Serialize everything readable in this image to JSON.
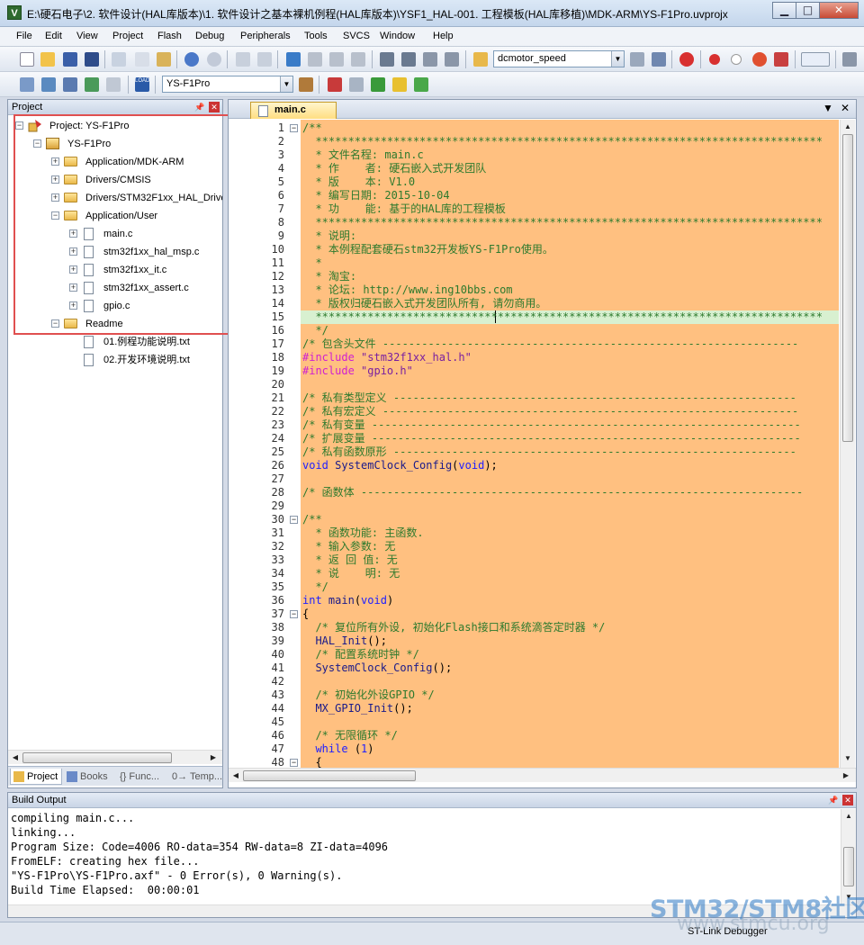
{
  "window": {
    "title": "E:\\硬石电子\\2. 软件设计(HAL库版本)\\1. 软件设计之基本裸机例程(HAL库版本)\\YSF1_HAL-001. 工程模板(HAL库移植)\\MDK-ARM\\YS-F1Pro.uvprojx",
    "app_icon_letter": "V"
  },
  "menu": [
    "File",
    "Edit",
    "View",
    "Project",
    "Flash",
    "Debug",
    "Peripherals",
    "Tools",
    "SVCS",
    "Window",
    "Help"
  ],
  "toolbar": {
    "find_combo_value": "dcmotor_speed",
    "target_combo_value": "YS-F1Pro",
    "load_label": "LOAD"
  },
  "project_panel": {
    "title": "Project",
    "tree": [
      {
        "label": "Project: YS-F1Pro",
        "level": 0,
        "type": "project",
        "expander": "−"
      },
      {
        "label": "YS-F1Pro",
        "level": 1,
        "type": "target",
        "expander": "−"
      },
      {
        "label": "Application/MDK-ARM",
        "level": 2,
        "type": "folder",
        "expander": "+"
      },
      {
        "label": "Drivers/CMSIS",
        "level": 2,
        "type": "folder",
        "expander": "+"
      },
      {
        "label": "Drivers/STM32F1xx_HAL_Driver",
        "level": 2,
        "type": "folder",
        "expander": "+"
      },
      {
        "label": "Application/User",
        "level": 2,
        "type": "folder",
        "expander": "−"
      },
      {
        "label": "main.c",
        "level": 3,
        "type": "file",
        "expander": "+"
      },
      {
        "label": "stm32f1xx_hal_msp.c",
        "level": 3,
        "type": "file",
        "expander": "+"
      },
      {
        "label": "stm32f1xx_it.c",
        "level": 3,
        "type": "file",
        "expander": "+"
      },
      {
        "label": "stm32f1xx_assert.c",
        "level": 3,
        "type": "file",
        "expander": "+"
      },
      {
        "label": "gpio.c",
        "level": 3,
        "type": "file",
        "expander": "+"
      },
      {
        "label": "Readme",
        "level": 2,
        "type": "folder",
        "expander": "−"
      },
      {
        "label": "01.例程功能说明.txt",
        "level": 3,
        "type": "file",
        "expander": ""
      },
      {
        "label": "02.开发环境说明.txt",
        "level": 3,
        "type": "file",
        "expander": ""
      }
    ],
    "tabs": [
      "Project",
      "Books",
      "{} Func...",
      "0→ Temp..."
    ]
  },
  "editor": {
    "active_tab": "main.c",
    "lines": [
      {
        "n": "1",
        "fold": "−",
        "segs": [
          [
            "c-comment",
            "/**"
          ]
        ]
      },
      {
        "n": "2",
        "segs": [
          [
            "c-comment",
            "  ******************************************************************************"
          ]
        ]
      },
      {
        "n": "3",
        "segs": [
          [
            "c-comment",
            "  * 文件名程: main.c"
          ]
        ]
      },
      {
        "n": "4",
        "segs": [
          [
            "c-comment",
            "  * 作    者: 硬石嵌入式开发团队"
          ]
        ]
      },
      {
        "n": "5",
        "segs": [
          [
            "c-comment",
            "  * 版    本: V1.0"
          ]
        ]
      },
      {
        "n": "6",
        "segs": [
          [
            "c-comment",
            "  * 编写日期: 2015-10-04"
          ]
        ]
      },
      {
        "n": "7",
        "segs": [
          [
            "c-comment",
            "  * 功    能: 基于的HAL库的工程模板"
          ]
        ]
      },
      {
        "n": "8",
        "segs": [
          [
            "c-comment",
            "  ******************************************************************************"
          ]
        ]
      },
      {
        "n": "9",
        "segs": [
          [
            "c-comment",
            "  * 说明:"
          ]
        ]
      },
      {
        "n": "10",
        "segs": [
          [
            "c-comment",
            "  * 本例程配套硬石stm32开发板YS-F1Pro使用。"
          ]
        ]
      },
      {
        "n": "11",
        "segs": [
          [
            "c-comment",
            "  *"
          ]
        ]
      },
      {
        "n": "12",
        "segs": [
          [
            "c-comment",
            "  * 淘宝:"
          ]
        ]
      },
      {
        "n": "13",
        "segs": [
          [
            "c-comment",
            "  * 论坛: http://www.ing10bbs.com"
          ]
        ]
      },
      {
        "n": "14",
        "segs": [
          [
            "c-comment",
            "  * 版权归硬石嵌入式开发团队所有, 请勿商用。"
          ]
        ]
      },
      {
        "n": "15",
        "segs": [
          [
            "c-comment",
            "  ******************************************************************************"
          ]
        ],
        "highlight": true
      },
      {
        "n": "16",
        "segs": [
          [
            "c-comment",
            "  */"
          ]
        ]
      },
      {
        "n": "17",
        "segs": [
          [
            "c-comment",
            "/* 包含头文件 ----------------------------------------------------------------"
          ]
        ]
      },
      {
        "n": "18",
        "segs": [
          [
            "c-pre",
            "#include "
          ],
          [
            "c-str",
            "\"stm32f1xx_hal.h\""
          ]
        ]
      },
      {
        "n": "19",
        "segs": [
          [
            "c-pre",
            "#include "
          ],
          [
            "c-str",
            "\"gpio.h\""
          ]
        ]
      },
      {
        "n": "20",
        "segs": [
          [
            "c-txt",
            ""
          ]
        ]
      },
      {
        "n": "21",
        "segs": [
          [
            "c-comment",
            "/* 私有类型定义 --------------------------------------------------------------"
          ]
        ]
      },
      {
        "n": "22",
        "segs": [
          [
            "c-comment",
            "/* 私有宏定义 ----------------------------------------------------------------"
          ]
        ]
      },
      {
        "n": "23",
        "segs": [
          [
            "c-comment",
            "/* 私有变量 ------------------------------------------------------------------"
          ]
        ]
      },
      {
        "n": "24",
        "segs": [
          [
            "c-comment",
            "/* 扩展变量 ------------------------------------------------------------------"
          ]
        ]
      },
      {
        "n": "25",
        "segs": [
          [
            "c-comment",
            "/* 私有函数原形 --------------------------------------------------------------"
          ]
        ]
      },
      {
        "n": "26",
        "segs": [
          [
            "c-kw",
            "void "
          ],
          [
            "c-fn",
            "SystemClock_Config"
          ],
          [
            "c-txt",
            "("
          ],
          [
            "c-kw",
            "void"
          ],
          [
            "c-txt",
            ");"
          ]
        ]
      },
      {
        "n": "27",
        "segs": [
          [
            "c-txt",
            ""
          ]
        ]
      },
      {
        "n": "28",
        "segs": [
          [
            "c-comment",
            "/* 函数体 --------------------------------------------------------------------"
          ]
        ]
      },
      {
        "n": "29",
        "segs": [
          [
            "c-txt",
            ""
          ]
        ]
      },
      {
        "n": "30",
        "fold": "−",
        "segs": [
          [
            "c-comment",
            "/**"
          ]
        ]
      },
      {
        "n": "31",
        "segs": [
          [
            "c-comment",
            "  * 函数功能: 主函数."
          ]
        ]
      },
      {
        "n": "32",
        "segs": [
          [
            "c-comment",
            "  * 输入参数: 无"
          ]
        ]
      },
      {
        "n": "33",
        "segs": [
          [
            "c-comment",
            "  * 返 回 值: 无"
          ]
        ]
      },
      {
        "n": "34",
        "segs": [
          [
            "c-comment",
            "  * 说    明: 无"
          ]
        ]
      },
      {
        "n": "35",
        "segs": [
          [
            "c-comment",
            "  */"
          ]
        ]
      },
      {
        "n": "36",
        "segs": [
          [
            "c-kw",
            "int "
          ],
          [
            "c-fn",
            "main"
          ],
          [
            "c-txt",
            "("
          ],
          [
            "c-kw",
            "void"
          ],
          [
            "c-txt",
            ")"
          ]
        ]
      },
      {
        "n": "37",
        "fold": "−",
        "segs": [
          [
            "c-txt",
            "{"
          ]
        ]
      },
      {
        "n": "38",
        "segs": [
          [
            "c-comment",
            "  /* 复位所有外设, 初始化Flash接口和系统滴答定时器 */"
          ]
        ]
      },
      {
        "n": "39",
        "segs": [
          [
            "c-txt",
            "  "
          ],
          [
            "c-fn",
            "HAL_Init"
          ],
          [
            "c-txt",
            "();"
          ]
        ]
      },
      {
        "n": "40",
        "segs": [
          [
            "c-comment",
            "  /* 配置系统时钟 */"
          ]
        ]
      },
      {
        "n": "41",
        "segs": [
          [
            "c-txt",
            "  "
          ],
          [
            "c-fn",
            "SystemClock_Config"
          ],
          [
            "c-txt",
            "();"
          ]
        ]
      },
      {
        "n": "42",
        "segs": [
          [
            "c-txt",
            ""
          ]
        ]
      },
      {
        "n": "43",
        "segs": [
          [
            "c-comment",
            "  /* 初始化外设GPIO */"
          ]
        ]
      },
      {
        "n": "44",
        "segs": [
          [
            "c-txt",
            "  "
          ],
          [
            "c-fn",
            "MX_GPIO_Init"
          ],
          [
            "c-txt",
            "();"
          ]
        ]
      },
      {
        "n": "45",
        "segs": [
          [
            "c-txt",
            ""
          ]
        ]
      },
      {
        "n": "46",
        "segs": [
          [
            "c-comment",
            "  /* 无限循环 */"
          ]
        ]
      },
      {
        "n": "47",
        "segs": [
          [
            "c-txt",
            "  "
          ],
          [
            "c-kw",
            "while "
          ],
          [
            "c-txt",
            "("
          ],
          [
            "c-kw",
            "1"
          ],
          [
            "c-txt",
            ")"
          ]
        ]
      },
      {
        "n": "48",
        "fold": "−",
        "segs": [
          [
            "c-txt",
            "  {"
          ]
        ]
      }
    ]
  },
  "build_output": {
    "title": "Build Output",
    "lines": [
      "compiling main.c...",
      "linking...",
      "Program Size: Code=4006 RO-data=354 RW-data=8 ZI-data=4096",
      "FromELF: creating hex file...",
      "\"YS-F1Pro\\YS-F1Pro.axf\" - 0 Error(s), 0 Warning(s).",
      "Build Time Elapsed:  00:00:01"
    ]
  },
  "status_bar": {
    "debugger": "ST-Link Debugger"
  },
  "watermark": {
    "line1": "STM32/STM8社区",
    "line2": "www.stmcu.org"
  }
}
